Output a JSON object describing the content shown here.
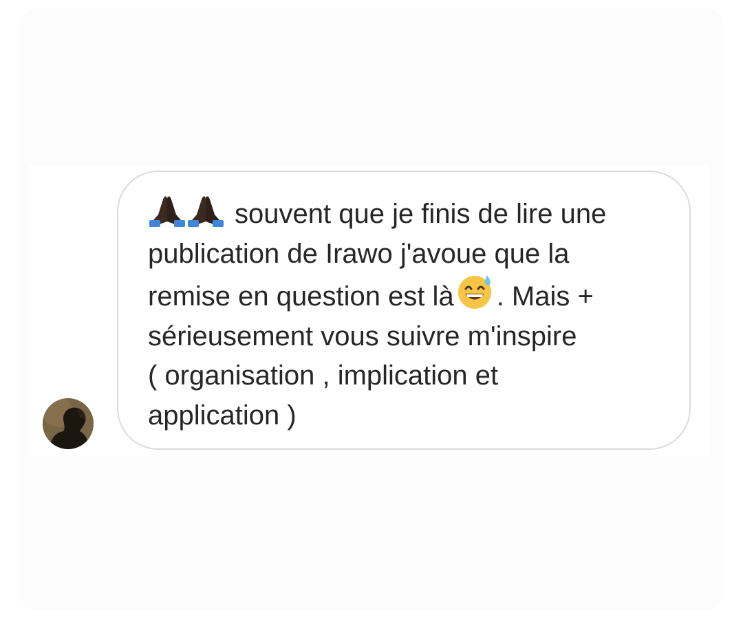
{
  "conversation": {
    "message": {
      "emoji_leading": [
        "folded-hands-icon",
        "folded-hands-icon"
      ],
      "lines": [
        "souvent que je finis de lire une",
        "publication de Irawo j'avoue que la",
        "remise en question est là",
        ". Mais +",
        "sérieusement vous suivre m'inspire",
        "( organisation , implication et",
        "application )"
      ],
      "emoji_inline": "grinning-sweat-face-icon"
    },
    "sender": {
      "avatar": "profile-photo"
    }
  }
}
